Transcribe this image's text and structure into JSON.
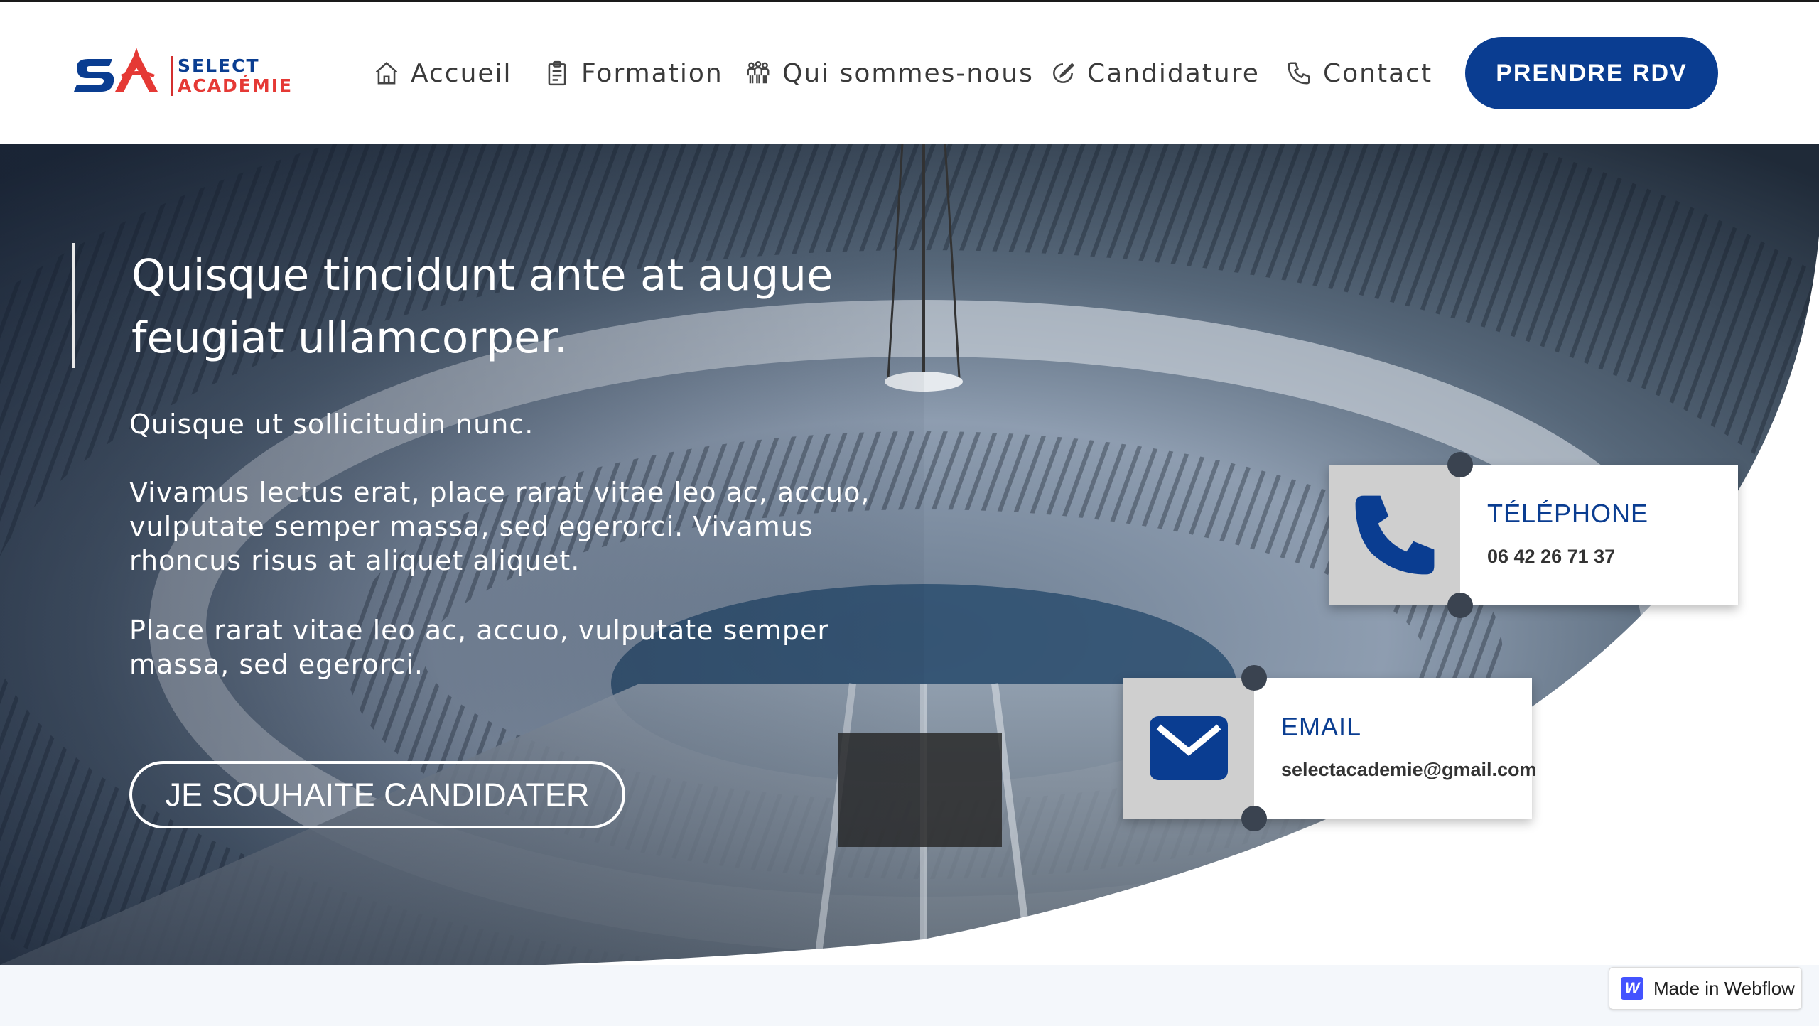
{
  "brand": {
    "logo_line1": "SELECT",
    "logo_line2": "ACADÉMIE",
    "primary_color": "#0a3d91",
    "accent_color": "#e53935"
  },
  "nav": {
    "items": [
      {
        "label": "Accueil",
        "icon": "home-icon"
      },
      {
        "label": "Formation",
        "icon": "clipboard-icon"
      },
      {
        "label": "Qui sommes-nous",
        "icon": "team-icon"
      },
      {
        "label": "Candidature",
        "icon": "edit-icon"
      },
      {
        "label": "Contact",
        "icon": "phone-icon"
      }
    ],
    "cta_label": "PRENDRE RDV"
  },
  "hero": {
    "title": "Quisque tincidunt ante at augue feugiat ullamcorper.",
    "paragraph1": "Quisque ut sollicitudin nunc.",
    "paragraph2": "Vivamus lectus erat, place rarat vitae leo ac, accuo, vulputate semper massa, sed egerorci. Vivamus rhoncus risus at aliquet aliquet.",
    "paragraph3": "Place rarat vitae leo ac, accuo, vulputate semper massa, sed egerorci.",
    "cta_label": "JE SOUHAITE CANDIDATER"
  },
  "contact_cards": {
    "phone": {
      "title": "TÉLÉPHONE",
      "value": "06 42 26 71 37",
      "icon": "phone-icon"
    },
    "email": {
      "title": "EMAIL",
      "value": "selectacademie@gmail.com",
      "icon": "envelope-icon"
    }
  },
  "badge": {
    "label": "Made in Webflow",
    "logo_letter": "W"
  }
}
